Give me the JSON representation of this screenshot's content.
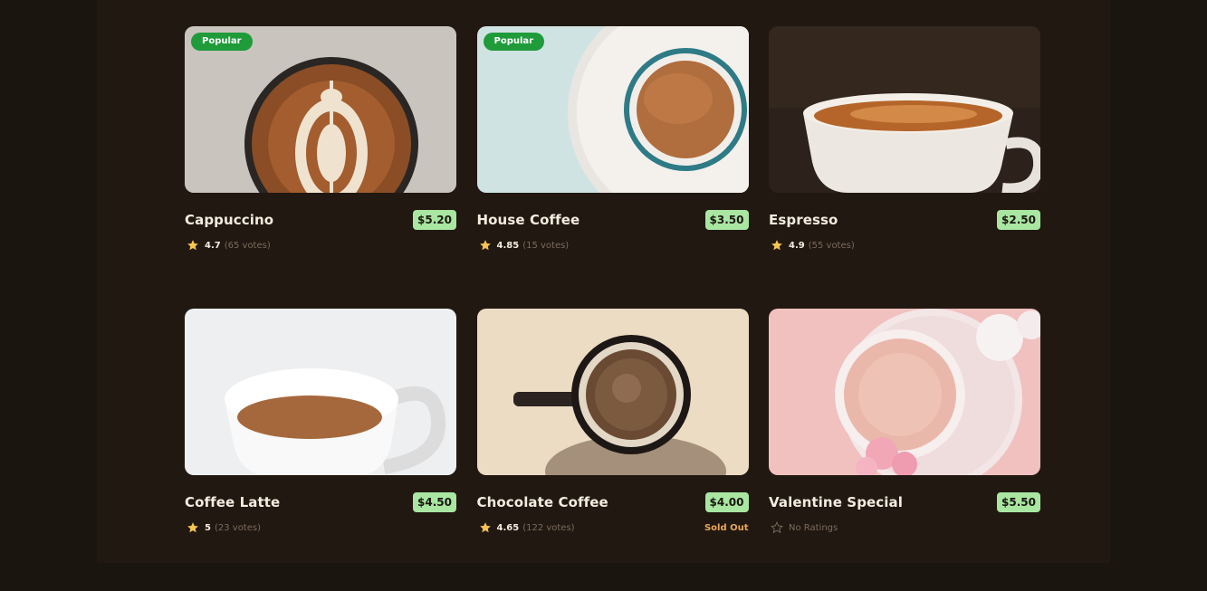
{
  "products": [
    {
      "name": "Cappuccino",
      "price": "$5.20",
      "badge": "Popular",
      "rating": "4.7",
      "votes": "(65 votes)"
    },
    {
      "name": "House Coffee",
      "price": "$3.50",
      "badge": "Popular",
      "rating": "4.85",
      "votes": "(15 votes)"
    },
    {
      "name": "Espresso",
      "price": "$2.50",
      "rating": "4.9",
      "votes": "(55 votes)"
    },
    {
      "name": "Coffee Latte",
      "price": "$4.50",
      "rating": "5",
      "votes": "(23 votes)"
    },
    {
      "name": "Chocolate Coffee",
      "price": "$4.00",
      "rating": "4.65",
      "votes": "(122 votes)",
      "status": "Sold Out"
    },
    {
      "name": "Valentine Special",
      "price": "$5.50",
      "no_rating_label": "No Ratings"
    }
  ],
  "colors": {
    "background": "#1b1510",
    "badge": "#1f9b3a",
    "price_tag": "#a8e6a1",
    "star": "#f6c453",
    "sold_out": "#e8a75a"
  },
  "icons": {
    "rating": "star-icon",
    "no_rating": "star-outline-icon"
  }
}
